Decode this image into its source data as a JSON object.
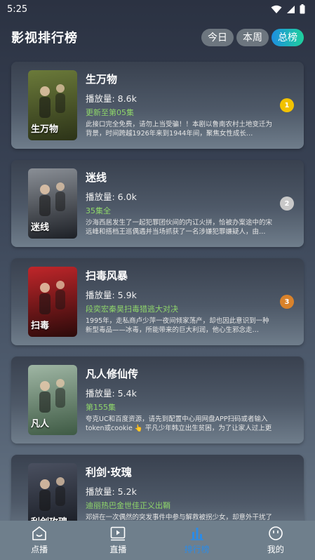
{
  "status": {
    "time": "5:25"
  },
  "header": {
    "title": "影视排行榜",
    "tabs": [
      {
        "label": "今日",
        "active": false
      },
      {
        "label": "本周",
        "active": false
      },
      {
        "label": "总榜",
        "active": true
      }
    ]
  },
  "items": [
    {
      "title": "生万物",
      "plays": "播放量: 8.6k",
      "update": "更新至第05集",
      "desc": "此接口完全免费，请勿上当受骗！！本剧以鲁南农村土地变迁为背景，时间跨越1926年来到1944年间，聚焦女性成长…",
      "rank": "1",
      "rank_color": "#f2c200",
      "poster_text": "生万物",
      "poster_colors": [
        "#6b7a3a",
        "#2c3318"
      ]
    },
    {
      "title": "迷线",
      "plays": "播放量: 6.0k",
      "update": "35集全",
      "desc": "沙海西居发生了一起犯罪团伙间的内讧火拼，恰被办案途中的宋远峰和搭档王巡偶遇并当场抓获了一名涉嫌犯罪嫌疑人，由…",
      "rank": "2",
      "rank_color": "#c8c8c8",
      "poster_text": "迷线",
      "poster_colors": [
        "#8a8f96",
        "#1d2026"
      ]
    },
    {
      "title": "扫毒风暴",
      "plays": "播放量: 5.9k",
      "update": "段奕宏秦昊扫毒猎逃大对决",
      "desc": "1995年，走私商卢少萍一夜间倾家荡产，却也因此意识到一种新型毒品——冰毒，所能带来的巨大利润，他心生邪念走…",
      "rank": "3",
      "rank_color": "#d9822b",
      "poster_text": "扫毒",
      "poster_colors": [
        "#c0262a",
        "#2b0a0a"
      ]
    },
    {
      "title": "凡人修仙传",
      "plays": "播放量: 5.4k",
      "update": "第155集",
      "desc": "夸克UC和百度资源，请先到配置中心用网盘APP扫码或者输入token或cookie 👆 平凡少年韩立出生贫困，为了让家人过上更好的生活，…",
      "rank": "",
      "rank_color": "",
      "poster_text": "凡人",
      "poster_colors": [
        "#9fb6a4",
        "#3e5a44"
      ]
    },
    {
      "title": "利剑·玫瑰",
      "plays": "播放量: 5.2k",
      "update": "迪丽热巴金世佳正义出鞘",
      "desc": "邓妍在一次偶然的突发事件中参与解救被拐少女，却意外干扰了打拐…",
      "rank": "",
      "rank_color": "",
      "poster_text": "利剑玫瑰",
      "poster_colors": [
        "#4a5060",
        "#15181f"
      ]
    }
  ],
  "nav": [
    {
      "label": "点播",
      "icon": "home-icon",
      "active": false
    },
    {
      "label": "直播",
      "icon": "play-icon",
      "active": false
    },
    {
      "label": "排行榜",
      "icon": "chart-icon",
      "active": true
    },
    {
      "label": "我的",
      "icon": "smile-icon",
      "active": false
    }
  ]
}
